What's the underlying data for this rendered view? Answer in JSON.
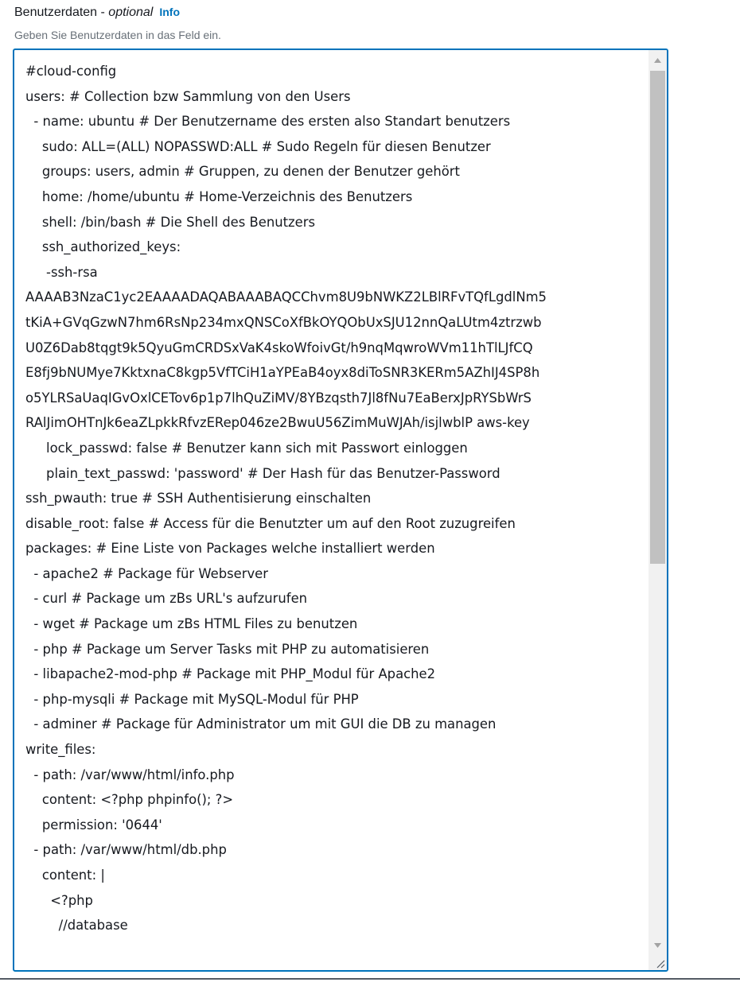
{
  "field": {
    "label": "Benutzerdaten",
    "separator": " - ",
    "optional": "optional",
    "info_link": "Info",
    "description": "Geben Sie Benutzerdaten in das Feld ein."
  },
  "textarea": {
    "lines": [
      "#cloud-config",
      "users: # Collection bzw Sammlung von den Users",
      "  - name: ubuntu # Der Benutzername des ersten also Standart benutzers",
      "    sudo: ALL=(ALL) NOPASSWD:ALL # Sudo Regeln für diesen Benutzer",
      "    groups: users, admin # Gruppen, zu denen der Benutzer gehört",
      "    home: /home/ubuntu # Home-Verzeichnis des Benutzers",
      "    shell: /bin/bash # Die Shell des Benutzers",
      "    ssh_authorized_keys:",
      "     -ssh-rsa",
      "AAAAB3NzaC1yc2EAAAADAQABAAABAQCChvm8U9bNWKZ2LBlRFvTQfLgdlNm5",
      "tKiA+GVqGzwN7hm6RsNp234mxQNSCoXfBkOYQObUxSJU12nnQaLUtm4ztrzwb",
      "U0Z6Dab8tqgt9k5QyuGmCRDSxVaK4skoWfoivGt/h9nqMqwroWVm11hTlLJfCQ",
      "E8fj9bNUMye7KktxnaC8kgp5VfTCiH1aYPEaB4oyx8diToSNR3KERm5AZhIJ4SP8h",
      "o5YLRSaUaqIGvOxlCETov6p1p7lhQuZiMV/8YBzqsth7Jl8fNu7EaBerxJpRYSbWrS",
      "RAlJimOHTnJk6eaZLpkkRfvzERep046ze2BwuU56ZimMuWJAh/isjlwblP aws-key",
      "     lock_passwd: false # Benutzer kann sich mit Passwort einloggen",
      "     plain_text_passwd: 'password' # Der Hash für das Benutzer-Password",
      "ssh_pwauth: true # SSH Authentisierung einschalten",
      "disable_root: false # Access für die Benutzter um auf den Root zuzugreifen",
      "packages: # Eine Liste von Packages welche installiert werden",
      "  - apache2 # Package für Webserver",
      "  - curl # Package um zBs URL's aufzurufen",
      "  - wget # Package um zBs HTML Files zu benutzen",
      "  - php # Package um Server Tasks mit PHP zu automatisieren",
      "  - libapache2-mod-php # Package mit PHP_Modul für Apache2",
      "  - php-mysqli # Package mit MySQL-Modul für PHP",
      "  - adminer # Package für Administrator um mit GUI die DB zu managen",
      "write_files:",
      "  - path: /var/www/html/info.php",
      "    content: <?php phpinfo(); ?>",
      "    permission: '0644'",
      "  - path: /var/www/html/db.php",
      "    content: |",
      "      <?php",
      "        //database"
    ]
  },
  "scrollbar": {
    "up_icon": "triangle-up",
    "down_icon": "triangle-down"
  },
  "colors": {
    "focus_border": "#0073bb",
    "info_link": "#0073bb",
    "description_text": "#687078",
    "scrollbar_track": "#f1f1f1",
    "scrollbar_thumb": "#c1c1c1"
  }
}
